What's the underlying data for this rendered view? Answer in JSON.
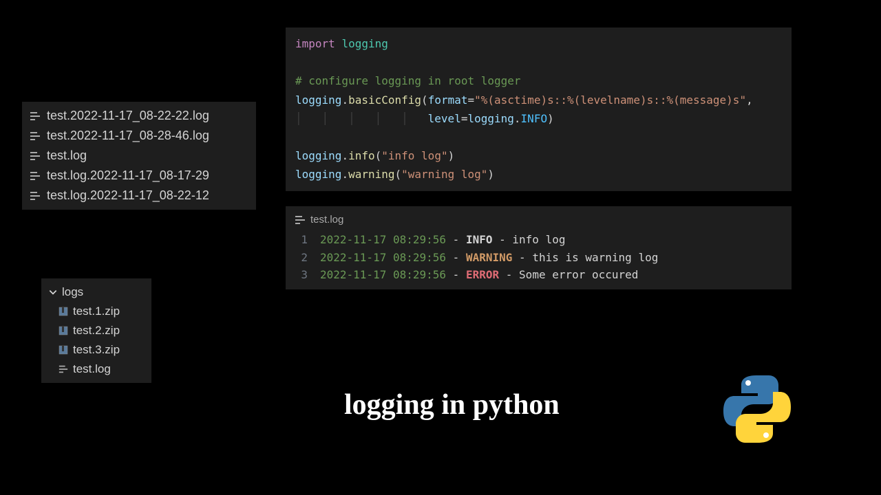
{
  "file_list": {
    "items": [
      "test.2022-11-17_08-22-22.log",
      "test.2022-11-17_08-28-46.log",
      "test.log",
      "test.log.2022-11-17_08-17-29",
      "test.log.2022-11-17_08-22-12"
    ]
  },
  "folder_tree": {
    "folder_name": "logs",
    "children": [
      {
        "name": "test.1.zip",
        "type": "zip"
      },
      {
        "name": "test.2.zip",
        "type": "zip"
      },
      {
        "name": "test.3.zip",
        "type": "zip"
      },
      {
        "name": "test.log",
        "type": "log"
      }
    ]
  },
  "code": {
    "line1": {
      "import": "import",
      "module": "logging"
    },
    "line3_comment": "# configure logging in root logger",
    "line4": {
      "obj": "logging",
      "fn": "basicConfig",
      "param_format": "format",
      "format_str": "\"%(asctime)s::%(levelname)s::%(message)s\""
    },
    "line5": {
      "param_level": "level",
      "obj": "logging",
      "enum": "INFO"
    },
    "line7": {
      "obj": "logging",
      "fn": "info",
      "arg": "\"info log\""
    },
    "line8": {
      "obj": "logging",
      "fn": "warning",
      "arg": "\"warning log\""
    }
  },
  "log_output": {
    "tab_label": "test.log",
    "lines": [
      {
        "n": "1",
        "ts": "2022-11-17 08:29:56",
        "level": "INFO",
        "msg": "info log"
      },
      {
        "n": "2",
        "ts": "2022-11-17 08:29:56",
        "level": "WARNING",
        "msg": "this is warning log"
      },
      {
        "n": "3",
        "ts": "2022-11-17 08:29:56",
        "level": "ERROR",
        "msg": "Some error occured"
      }
    ]
  },
  "title": "logging in python"
}
